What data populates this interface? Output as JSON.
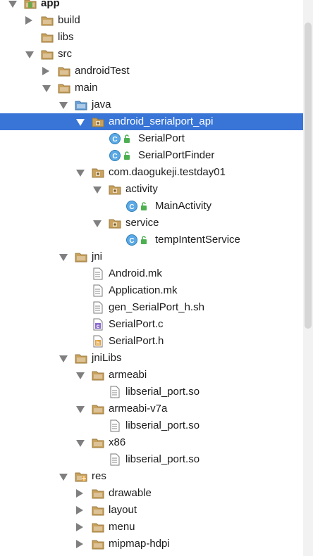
{
  "tree": [
    {
      "label": "app",
      "icon": "module-icon",
      "depth": 0,
      "state": "expanded",
      "bold": true,
      "selected": false
    },
    {
      "label": "build",
      "icon": "folder-icon",
      "depth": 1,
      "state": "collapsed",
      "selected": false
    },
    {
      "label": "libs",
      "icon": "folder-icon",
      "depth": 1,
      "state": "none",
      "selected": false
    },
    {
      "label": "src",
      "icon": "folder-icon",
      "depth": 1,
      "state": "expanded",
      "selected": false
    },
    {
      "label": "androidTest",
      "icon": "folder-icon",
      "depth": 2,
      "state": "collapsed",
      "selected": false
    },
    {
      "label": "main",
      "icon": "folder-icon",
      "depth": 2,
      "state": "expanded",
      "selected": false
    },
    {
      "label": "java",
      "icon": "source-folder-icon",
      "depth": 3,
      "state": "expanded",
      "selected": false
    },
    {
      "label": "android_serialport_api",
      "icon": "package-icon",
      "depth": 4,
      "state": "expanded",
      "selected": true
    },
    {
      "label": "SerialPort",
      "icon": "java-class-icon",
      "depth": 5,
      "state": "none",
      "selected": false
    },
    {
      "label": "SerialPortFinder",
      "icon": "java-class-icon",
      "depth": 5,
      "state": "none",
      "selected": false
    },
    {
      "label": "com.daogukeji.testday01",
      "icon": "package-icon",
      "depth": 4,
      "state": "expanded",
      "selected": false
    },
    {
      "label": "activity",
      "icon": "package-icon",
      "depth": 5,
      "state": "expanded",
      "selected": false
    },
    {
      "label": "MainActivity",
      "icon": "java-class-icon",
      "depth": 6,
      "state": "none",
      "selected": false
    },
    {
      "label": "service",
      "icon": "package-icon",
      "depth": 5,
      "state": "expanded",
      "selected": false
    },
    {
      "label": "tempIntentService",
      "icon": "java-class-icon",
      "depth": 6,
      "state": "none",
      "selected": false
    },
    {
      "label": "jni",
      "icon": "folder-icon",
      "depth": 3,
      "state": "expanded",
      "selected": false
    },
    {
      "label": "Android.mk",
      "icon": "text-file-icon",
      "depth": 4,
      "state": "none",
      "selected": false
    },
    {
      "label": "Application.mk",
      "icon": "text-file-icon",
      "depth": 4,
      "state": "none",
      "selected": false
    },
    {
      "label": "gen_SerialPort_h.sh",
      "icon": "text-file-icon",
      "depth": 4,
      "state": "none",
      "selected": false
    },
    {
      "label": "SerialPort.c",
      "icon": "c-file-icon",
      "depth": 4,
      "state": "none",
      "selected": false
    },
    {
      "label": "SerialPort.h",
      "icon": "h-file-icon",
      "depth": 4,
      "state": "none",
      "selected": false
    },
    {
      "label": "jniLibs",
      "icon": "folder-icon",
      "depth": 3,
      "state": "expanded",
      "selected": false
    },
    {
      "label": "armeabi",
      "icon": "folder-icon",
      "depth": 4,
      "state": "expanded",
      "selected": false
    },
    {
      "label": "libserial_port.so",
      "icon": "text-file-icon",
      "depth": 5,
      "state": "none",
      "selected": false
    },
    {
      "label": "armeabi-v7a",
      "icon": "folder-icon",
      "depth": 4,
      "state": "expanded",
      "selected": false
    },
    {
      "label": "libserial_port.so",
      "icon": "text-file-icon",
      "depth": 5,
      "state": "none",
      "selected": false
    },
    {
      "label": "x86",
      "icon": "folder-icon",
      "depth": 4,
      "state": "expanded",
      "selected": false
    },
    {
      "label": "libserial_port.so",
      "icon": "text-file-icon",
      "depth": 5,
      "state": "none",
      "selected": false
    },
    {
      "label": "res",
      "icon": "res-folder-icon",
      "depth": 3,
      "state": "expanded",
      "selected": false
    },
    {
      "label": "drawable",
      "icon": "folder-icon",
      "depth": 4,
      "state": "collapsed",
      "selected": false
    },
    {
      "label": "layout",
      "icon": "folder-icon",
      "depth": 4,
      "state": "collapsed",
      "selected": false
    },
    {
      "label": "menu",
      "icon": "folder-icon",
      "depth": 4,
      "state": "collapsed",
      "selected": false
    },
    {
      "label": "mipmap-hdpi",
      "icon": "folder-icon",
      "depth": 4,
      "state": "collapsed",
      "selected": false
    }
  ],
  "colors": {
    "selection": "#3875d7",
    "folder": "#c9a25e",
    "source_folder": "#6a9fd4",
    "class_circle": "#5aa9e6",
    "lock": "#4caf50"
  }
}
